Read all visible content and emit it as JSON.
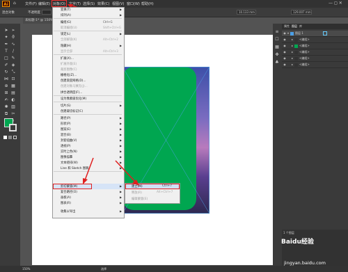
{
  "app": {
    "logo": "Ai"
  },
  "menubar": {
    "items": [
      "文件(F)",
      "编辑(E)",
      "对象(O)",
      "文字(T)",
      "选择(S)",
      "效果(C)",
      "视图(V)",
      "窗口(W)",
      "帮助(H)"
    ]
  },
  "controlbar": {
    "selection_label": "混合对象",
    "opacity_label": "不透明度",
    "stroke_value": "10.133 mm",
    "width_value": "129.007 mm"
  },
  "document": {
    "tab_title": "未标题-1* @ 150%"
  },
  "object_menu": {
    "items": [
      {
        "label": "变换(T)",
        "shortcut": "",
        "submenu": true,
        "disabled": false
      },
      {
        "label": "排列(A)",
        "shortcut": "",
        "submenu": true,
        "disabled": false
      },
      {
        "label": "编组(G)",
        "shortcut": "Ctrl+G",
        "submenu": false,
        "disabled": false
      },
      {
        "label": "取消编组(U)",
        "shortcut": "Shift+Ctrl+G",
        "submenu": false,
        "disabled": true
      },
      {
        "label": "锁定(L)",
        "shortcut": "",
        "submenu": true,
        "disabled": false
      },
      {
        "label": "全部解锁(K)",
        "shortcut": "Alt+Ctrl+2",
        "submenu": false,
        "disabled": true
      },
      {
        "label": "隐藏(H)",
        "shortcut": "",
        "submenu": true,
        "disabled": false
      },
      {
        "label": "显示全部",
        "shortcut": "Alt+Ctrl+3",
        "submenu": false,
        "disabled": true
      },
      {
        "label": "扩展(X)...",
        "shortcut": "",
        "submenu": false,
        "disabled": false
      },
      {
        "label": "扩展外观(E)",
        "shortcut": "",
        "submenu": false,
        "disabled": true
      },
      {
        "label": "裁剪图像(C)",
        "shortcut": "",
        "submenu": false,
        "disabled": true
      },
      {
        "label": "栅格化(Z)...",
        "shortcut": "",
        "submenu": false,
        "disabled": false
      },
      {
        "label": "创建渐变网格(D)...",
        "shortcut": "",
        "submenu": false,
        "disabled": false
      },
      {
        "label": "创建对象马赛克(J)...",
        "shortcut": "",
        "submenu": false,
        "disabled": true
      },
      {
        "label": "拼合透明度(F)...",
        "shortcut": "",
        "submenu": false,
        "disabled": false
      },
      {
        "label": "设为像素级优化(M)",
        "shortcut": "",
        "submenu": false,
        "disabled": false
      },
      {
        "label": "切片(S)",
        "shortcut": "",
        "submenu": true,
        "disabled": false
      },
      {
        "label": "创建裁切标记(C)",
        "shortcut": "",
        "submenu": false,
        "disabled": false
      },
      {
        "label": "路径(P)",
        "shortcut": "",
        "submenu": true,
        "disabled": false
      },
      {
        "label": "形状(P)",
        "shortcut": "",
        "submenu": true,
        "disabled": false
      },
      {
        "label": "图案(E)",
        "shortcut": "",
        "submenu": true,
        "disabled": false
      },
      {
        "label": "混合(B)",
        "shortcut": "",
        "submenu": true,
        "disabled": false
      },
      {
        "label": "封套扭曲(V)",
        "shortcut": "",
        "submenu": true,
        "disabled": false
      },
      {
        "label": "透视(P)",
        "shortcut": "",
        "submenu": true,
        "disabled": false
      },
      {
        "label": "实时上色(N)",
        "shortcut": "",
        "submenu": true,
        "disabled": false
      },
      {
        "label": "图像描摹",
        "shortcut": "",
        "submenu": true,
        "disabled": false
      },
      {
        "label": "文本绕排(W)",
        "shortcut": "",
        "submenu": true,
        "disabled": false
      },
      {
        "label": "Line 和 Sketch 图稿",
        "shortcut": "",
        "submenu": true,
        "disabled": false
      },
      {
        "label": "剪切蒙版(M)",
        "shortcut": "",
        "submenu": true,
        "disabled": false
      },
      {
        "label": "复合路径(O)",
        "shortcut": "",
        "submenu": true,
        "disabled": false
      },
      {
        "label": "画板(A)",
        "shortcut": "",
        "submenu": true,
        "disabled": false
      },
      {
        "label": "图表(R)",
        "shortcut": "",
        "submenu": true,
        "disabled": false
      },
      {
        "label": "收集以导出",
        "shortcut": "",
        "submenu": true,
        "disabled": false
      }
    ]
  },
  "clipping_submenu": {
    "items": [
      {
        "label": "建立(M)",
        "shortcut": "Ctrl+7",
        "disabled": false
      },
      {
        "label": "释放(R)",
        "shortcut": "Alt+Ctrl+7",
        "disabled": true
      },
      {
        "label": "编辑蒙版(E)",
        "shortcut": "",
        "disabled": true
      }
    ]
  },
  "layers_panel": {
    "tabs": [
      "属性",
      "图层",
      "库"
    ],
    "rows": [
      {
        "name": "图层 1"
      },
      {
        "name": "<编组>"
      },
      {
        "name": "<编组>"
      },
      {
        "name": "<编组>"
      },
      {
        "name": "<编组>"
      },
      {
        "name": "<编组>"
      }
    ],
    "footer_label": "1 个图层"
  },
  "statusbar": {
    "zoom": "150%",
    "tool": "选择"
  },
  "watermark": {
    "brand": "Baidu经验",
    "url": "jingyan.baidu.com"
  },
  "colors": {
    "fill": "#00a650",
    "highlight": "#e02020",
    "accent": "#4b9fe6"
  }
}
